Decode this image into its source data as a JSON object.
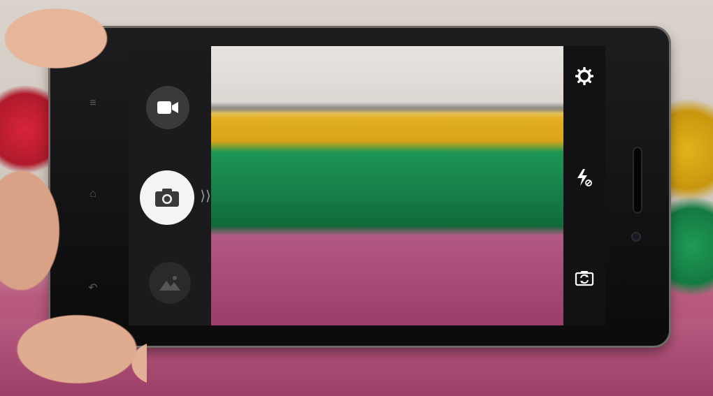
{
  "camera": {
    "left_rail": {
      "video_icon": "video-camera-icon",
      "shutter_icon": "camera-icon",
      "gallery_icon": "image-gallery-icon"
    },
    "right_rail": {
      "settings_icon": "gear-icon",
      "flash_icon": "flash-off-icon",
      "switch_camera_icon": "switch-camera-icon"
    }
  }
}
